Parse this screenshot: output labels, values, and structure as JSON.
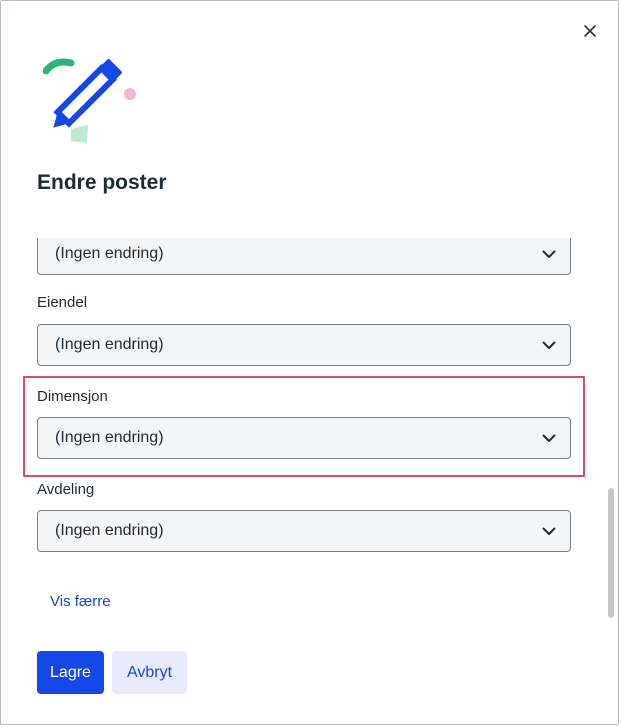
{
  "dialog": {
    "title": "Endre poster",
    "close_icon": "close-icon",
    "illustration_icon": "pencil-edit-icon"
  },
  "fields": [
    {
      "label": "",
      "value": "(Ingen endring)"
    },
    {
      "label": "Eiendel",
      "value": "(Ingen endring)"
    },
    {
      "label": "Dimensjon",
      "value": "(Ingen endring)",
      "highlighted": true
    },
    {
      "label": "Avdeling",
      "value": "(Ingen endring)"
    }
  ],
  "toggle_link": "Vis færre",
  "buttons": {
    "save": "Lagre",
    "cancel": "Avbryt"
  },
  "colors": {
    "primary": "#1548e6",
    "secondary_bg": "#e7ebfb",
    "highlight": "#d94f61",
    "text": "#1f2a37"
  }
}
